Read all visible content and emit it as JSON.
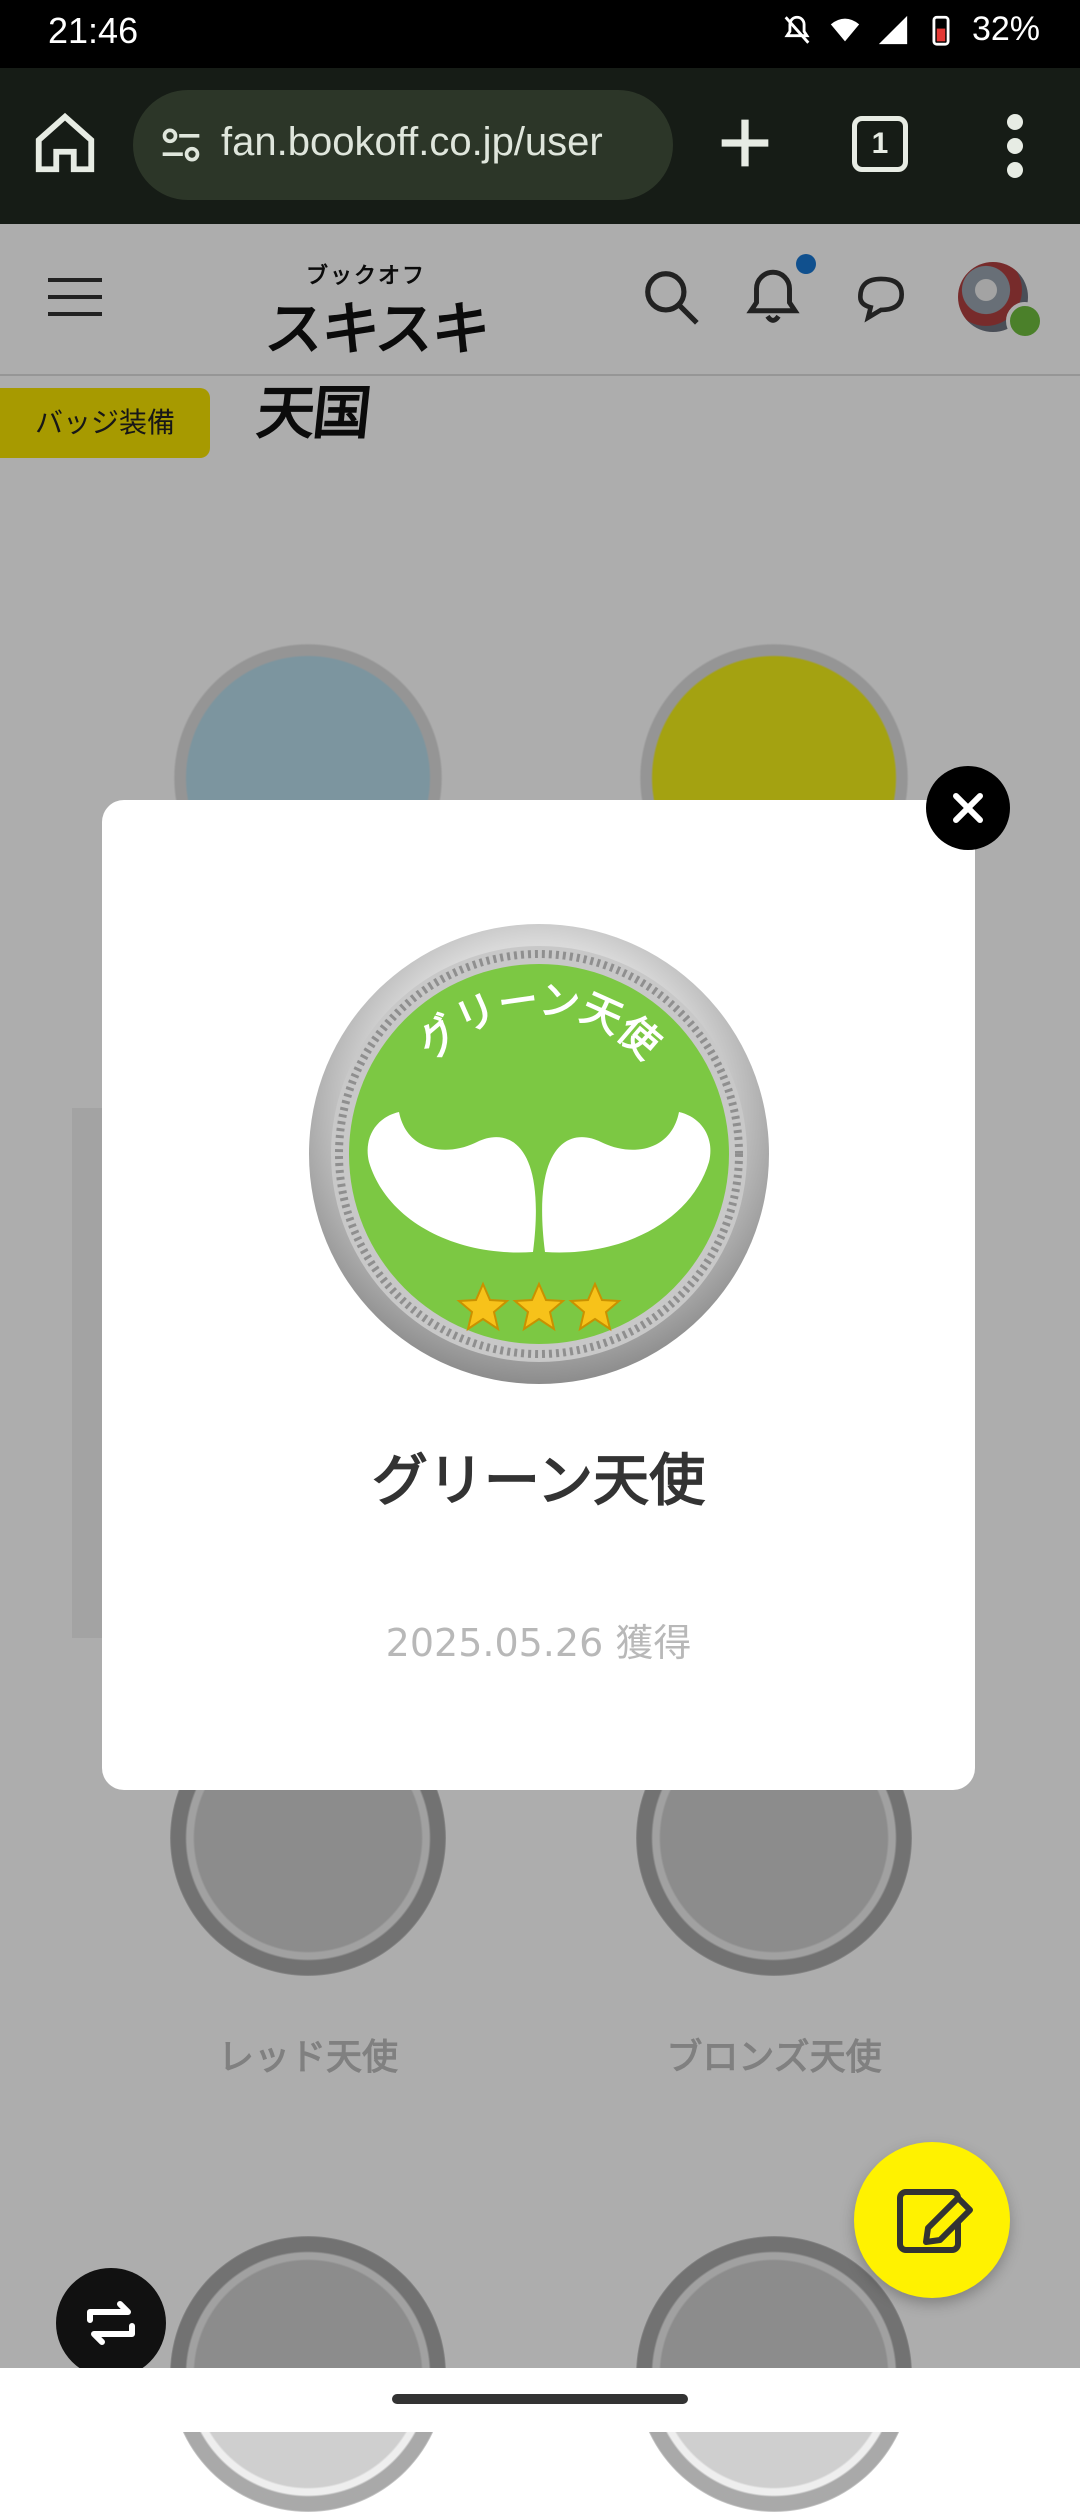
{
  "status_bar": {
    "time": "21:46",
    "battery": "32%"
  },
  "browser": {
    "url": "fan.bookoff.co.jp/user",
    "tab_count": "1"
  },
  "site_header": {
    "logo_small": "ブックオフ",
    "logo_big": "スキスキ天国"
  },
  "page": {
    "equip_badge_label": "バッジ装備",
    "badges_row3": [
      {
        "label": "レッド天使"
      },
      {
        "label": "ブロンズ天使"
      }
    ]
  },
  "modal": {
    "badge_ring_text": "グリーン天使",
    "title": "グリーン天使",
    "date": "2025.05.26 獲得",
    "stars": 3,
    "medal_color": "#7cc843"
  },
  "colors": {
    "accent_yellow": "#fff200",
    "brand_green": "#7cc843"
  }
}
